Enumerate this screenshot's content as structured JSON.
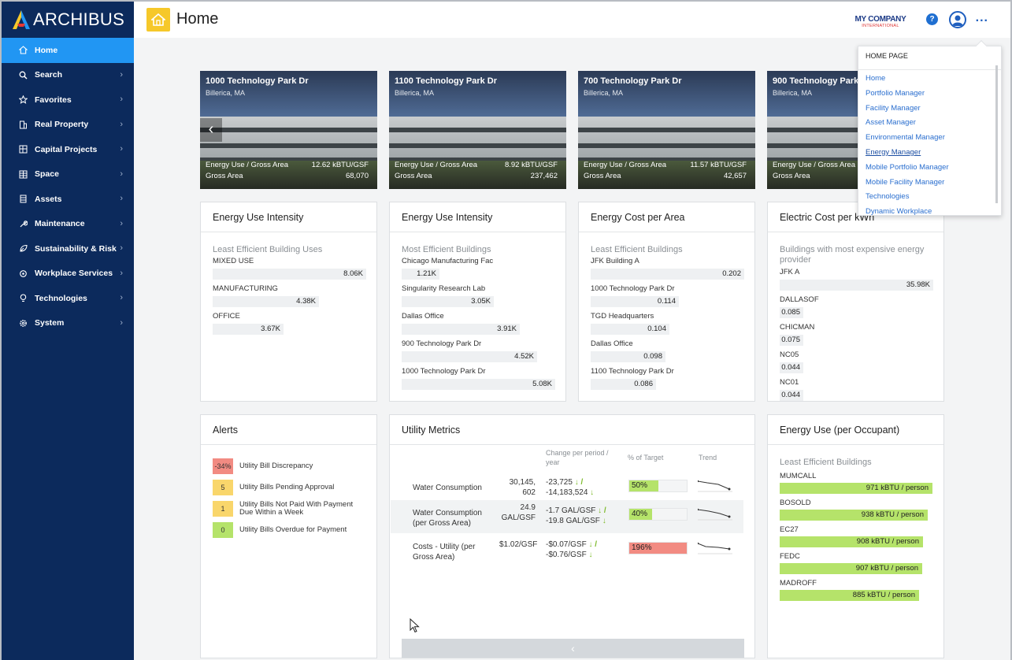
{
  "sidebar": {
    "brand": "ARCHIBUS",
    "items": [
      {
        "label": "Home",
        "icon": "home-icon"
      },
      {
        "label": "Search",
        "icon": "search-icon"
      },
      {
        "label": "Favorites",
        "icon": "star-icon"
      },
      {
        "label": "Real Property",
        "icon": "building-icon"
      },
      {
        "label": "Capital Projects",
        "icon": "chart-icon"
      },
      {
        "label": "Space",
        "icon": "floorplan-icon"
      },
      {
        "label": "Assets",
        "icon": "asset-icon"
      },
      {
        "label": "Maintenance",
        "icon": "wrench-icon"
      },
      {
        "label": "Sustainability & Risk",
        "icon": "leaf-icon"
      },
      {
        "label": "Workplace Services",
        "icon": "services-icon"
      },
      {
        "label": "Technologies",
        "icon": "bulb-icon"
      },
      {
        "label": "System",
        "icon": "gear-icon"
      }
    ]
  },
  "header": {
    "title": "Home",
    "company_line1": "MY COMPANY",
    "company_line2": "INTERNATIONAL",
    "help": "?",
    "more": "..."
  },
  "buildings": [
    {
      "name": "1000 Technology Park Dr",
      "city": "Billerica, MA",
      "m1_label": "Energy Use / Gross Area",
      "m1_value": "12.62 kBTU/GSF",
      "m2_label": "Gross Area",
      "m2_value": "68,070"
    },
    {
      "name": "1100 Technology Park Dr",
      "city": "Billerica, MA",
      "m1_label": "Energy Use / Gross Area",
      "m1_value": "8.92 kBTU/GSF",
      "m2_label": "Gross Area",
      "m2_value": "237,462"
    },
    {
      "name": "700 Technology Park Dr",
      "city": "Billerica, MA",
      "m1_label": "Energy Use / Gross Area",
      "m1_value": "11.57 kBTU/GSF",
      "m2_label": "Gross Area",
      "m2_value": "42,657"
    },
    {
      "name": "900 Technology Park Dr",
      "city": "Billerica, MA",
      "m1_label": "Energy Use / Gross Area",
      "m1_value": "",
      "m2_label": "Gross Area",
      "m2_value": ""
    }
  ],
  "panels": {
    "eui_least": {
      "title": "Energy Use Intensity",
      "subtitle": "Least Efficient Building Uses",
      "items": [
        {
          "label": "MIXED USE",
          "value": "8.06K"
        },
        {
          "label": "MANUFACTURING",
          "value": "4.38K"
        },
        {
          "label": "OFFICE",
          "value": "3.67K"
        }
      ]
    },
    "eui_most": {
      "title": "Energy Use Intensity",
      "subtitle": "Most Efficient Buildings",
      "items": [
        {
          "label": "Chicago Manufacturing Fac",
          "value": "1.21K"
        },
        {
          "label": "Singularity Research Lab",
          "value": "3.05K"
        },
        {
          "label": "Dallas Office",
          "value": "3.91K"
        },
        {
          "label": "900 Technology Park Dr",
          "value": "4.52K"
        },
        {
          "label": "1000 Technology Park Dr",
          "value": "5.08K"
        }
      ]
    },
    "cost_area": {
      "title": "Energy Cost per Area",
      "subtitle": "Least Efficient Buildings",
      "items": [
        {
          "label": "JFK Building A",
          "value": "0.202"
        },
        {
          "label": "1000 Technology Park Dr",
          "value": "0.114"
        },
        {
          "label": "TGD Headquarters",
          "value": "0.104"
        },
        {
          "label": "Dallas Office",
          "value": "0.098"
        },
        {
          "label": "1100 Technology Park Dr",
          "value": "0.086"
        }
      ]
    },
    "electric_cost": {
      "title": "Electric Cost per kWh",
      "subtitle": "Buildings with most expensive energy provider",
      "items": [
        {
          "label": "JFK A",
          "value": "35.98K"
        },
        {
          "label": "DALLASOF",
          "value": "0.085"
        },
        {
          "label": "CHICMAN",
          "value": "0.075"
        },
        {
          "label": "NC05",
          "value": "0.044"
        },
        {
          "label": "NC01",
          "value": "0.044"
        }
      ]
    },
    "alerts": {
      "title": "Alerts",
      "items": [
        {
          "badge": "-34%",
          "text": "Utility Bill Discrepancy",
          "color": "#f28b82"
        },
        {
          "badge": "5",
          "text": "Utility Bills Pending Approval",
          "color": "#f9d66b"
        },
        {
          "badge": "1",
          "text": "Utility Bills Not Paid With Payment Due Within a Week",
          "color": "#f9d66b"
        },
        {
          "badge": "0",
          "text": "Utility Bills Overdue for Payment",
          "color": "#b5e36a"
        }
      ]
    },
    "utility": {
      "title": "Utility Metrics",
      "headers": {
        "change": "Change per period / year",
        "target": "% of Target",
        "trend": "Trend"
      },
      "rows": [
        {
          "name": "Water Consumption",
          "value": "30,145, 602",
          "change1": "-23,725",
          "change2": "-14,183,524",
          "target": "50%",
          "target_fraction": 0.5,
          "color": "#b5e36a"
        },
        {
          "name": "Water Consumption (per Gross Area)",
          "value": "24.9 GAL/GSF",
          "change1": "-1.7 GAL/GSF",
          "change2": "-19.8 GAL/GSF",
          "target": "40%",
          "target_fraction": 0.4,
          "color": "#b5e36a"
        },
        {
          "name": "Costs - Utility (per Gross Area)",
          "value": "$1.02/GSF",
          "change1": "-$0.07/GSF",
          "change2": "-$0.76/GSF",
          "target": "196%",
          "target_fraction": 1.0,
          "color": "#f28b82"
        }
      ],
      "footer_arrow": "‹"
    },
    "occupant": {
      "title": "Energy Use (per Occupant)",
      "subtitle": "Least Efficient Buildings",
      "items": [
        {
          "label": "MUMCALL",
          "value": "971 kBTU / person",
          "fraction": 0.971
        },
        {
          "label": "BOSOLD",
          "value": "938 kBTU / person",
          "fraction": 0.938
        },
        {
          "label": "EC27",
          "value": "908 kBTU / person",
          "fraction": 0.908
        },
        {
          "label": "FEDC",
          "value": "907 kBTU / person",
          "fraction": 0.907
        },
        {
          "label": "MADROFF",
          "value": "885 kBTU / person",
          "fraction": 0.885
        }
      ]
    }
  },
  "dropdown": {
    "title": "HOME PAGE",
    "items": [
      "Home",
      "Portfolio Manager",
      "Facility Manager",
      "Asset Manager",
      "Environmental Manager",
      "Energy Manager",
      "Mobile Portfolio Manager",
      "Mobile Facility Manager",
      "Technologies",
      "Dynamic Workplace"
    ],
    "selected": "Energy Manager"
  }
}
